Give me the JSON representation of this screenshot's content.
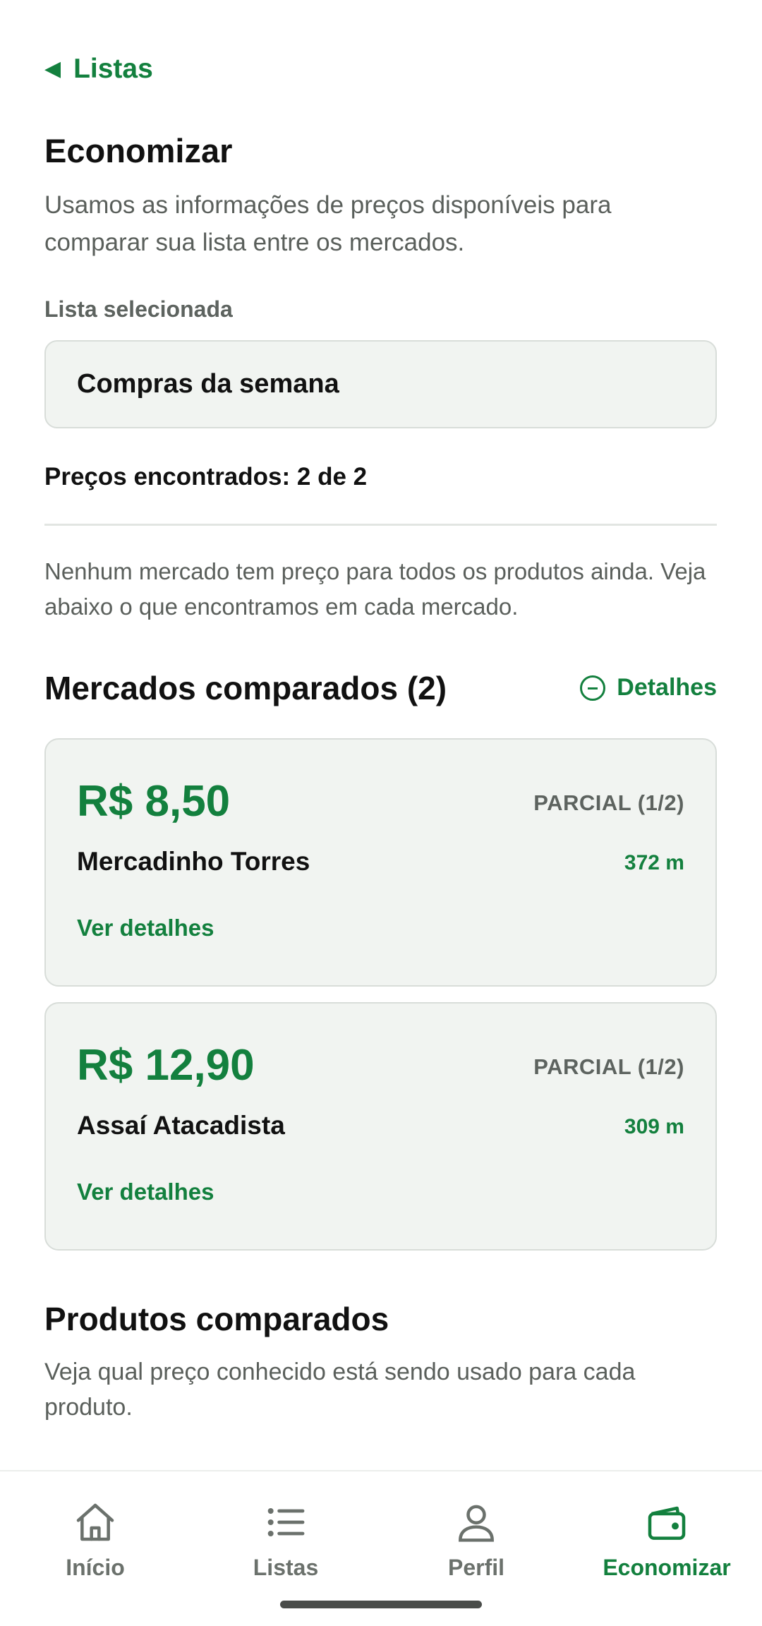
{
  "header": {
    "back_label": "Listas",
    "title": "Economizar",
    "intro": "Usamos as informações de preços disponíveis para comparar sua lista entre os mercados."
  },
  "selection": {
    "label": "Lista selecionada",
    "value": "Compras da semana"
  },
  "prices_found": "Preços encontrados: 2 de 2",
  "notice": "Nenhum mercado tem preço para todos os produtos ainda. Veja abaixo o que encontramos em cada mercado.",
  "markets": {
    "title": "Mercados comparados (2)",
    "details_label": "Detalhes",
    "cards": [
      {
        "price": "R$ 8,50",
        "status": "PARCIAL (1/2)",
        "name": "Mercadinho Torres",
        "distance": "372 m",
        "action": "Ver detalhes"
      },
      {
        "price": "R$ 12,90",
        "status": "PARCIAL (1/2)",
        "name": "Assaí Atacadista",
        "distance": "309 m",
        "action": "Ver detalhes"
      }
    ]
  },
  "products": {
    "title": "Produtos comparados",
    "subtitle": "Veja qual preço conhecido está sendo usado para cada produto."
  },
  "bottom_nav": {
    "items": [
      {
        "label": "Início",
        "icon": "home-icon"
      },
      {
        "label": "Listas",
        "icon": "list-icon"
      },
      {
        "label": "Perfil",
        "icon": "profile-icon"
      },
      {
        "label": "Economizar",
        "icon": "wallet-icon",
        "active": true
      }
    ]
  },
  "colors": {
    "accent": "#13803e",
    "card_background": "#f1f4f1",
    "muted_text": "#5a5f5b"
  }
}
